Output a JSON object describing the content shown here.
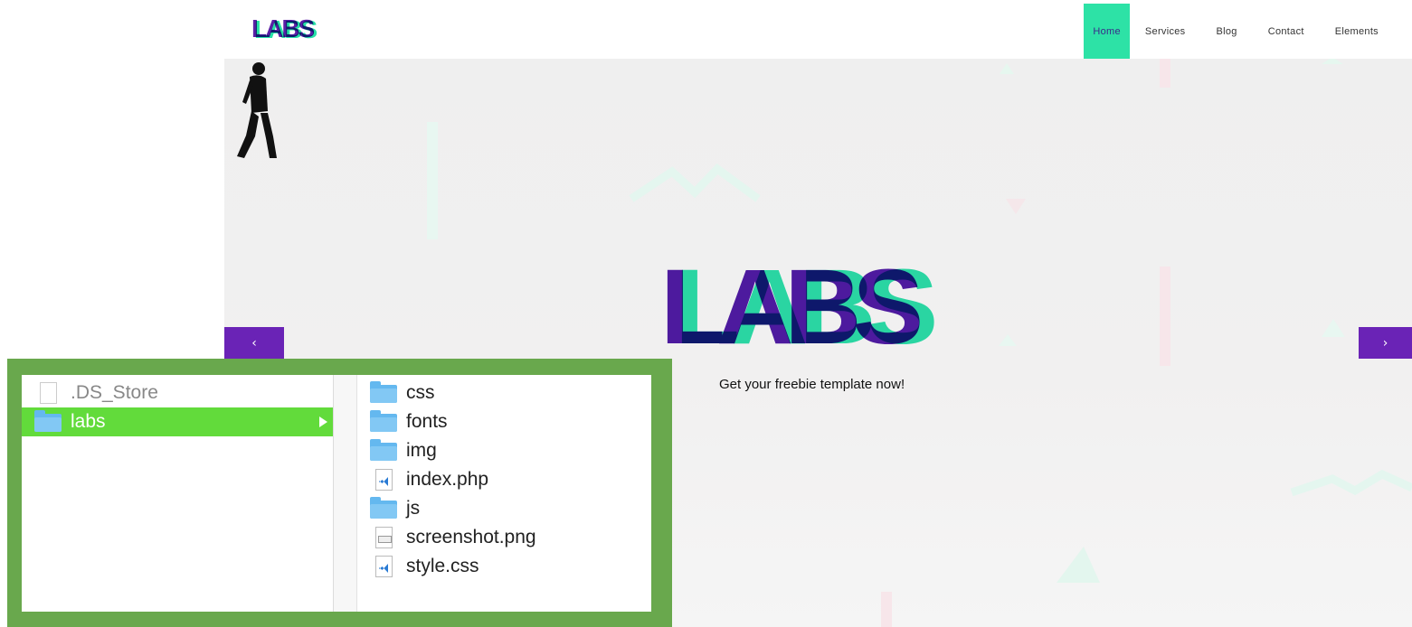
{
  "site": {
    "logo_text": "LABS",
    "nav": [
      {
        "label": "Home",
        "active": true
      },
      {
        "label": "Services",
        "active": false
      },
      {
        "label": "Blog",
        "active": false
      },
      {
        "label": "Contact",
        "active": false
      },
      {
        "label": "Elements",
        "active": false
      }
    ],
    "hero": {
      "title": "LABS",
      "tagline": "Get your freebie template now!",
      "prev_label": "‹",
      "next_label": "›"
    },
    "colors": {
      "accent_green": "#2de2a6",
      "accent_purple": "#6a23b6"
    }
  },
  "finder": {
    "column1": [
      {
        "name": ".DS_Store",
        "kind": "file",
        "selected": false
      },
      {
        "name": "labs",
        "kind": "folder",
        "selected": true
      }
    ],
    "column2": [
      {
        "name": "css",
        "kind": "folder"
      },
      {
        "name": "fonts",
        "kind": "folder"
      },
      {
        "name": "img",
        "kind": "folder"
      },
      {
        "name": "index.php",
        "kind": "code"
      },
      {
        "name": "js",
        "kind": "folder"
      },
      {
        "name": "screenshot.png",
        "kind": "image"
      },
      {
        "name": "style.css",
        "kind": "code"
      }
    ],
    "frame_color": "#69a84d",
    "selection_color": "#62db3b"
  }
}
